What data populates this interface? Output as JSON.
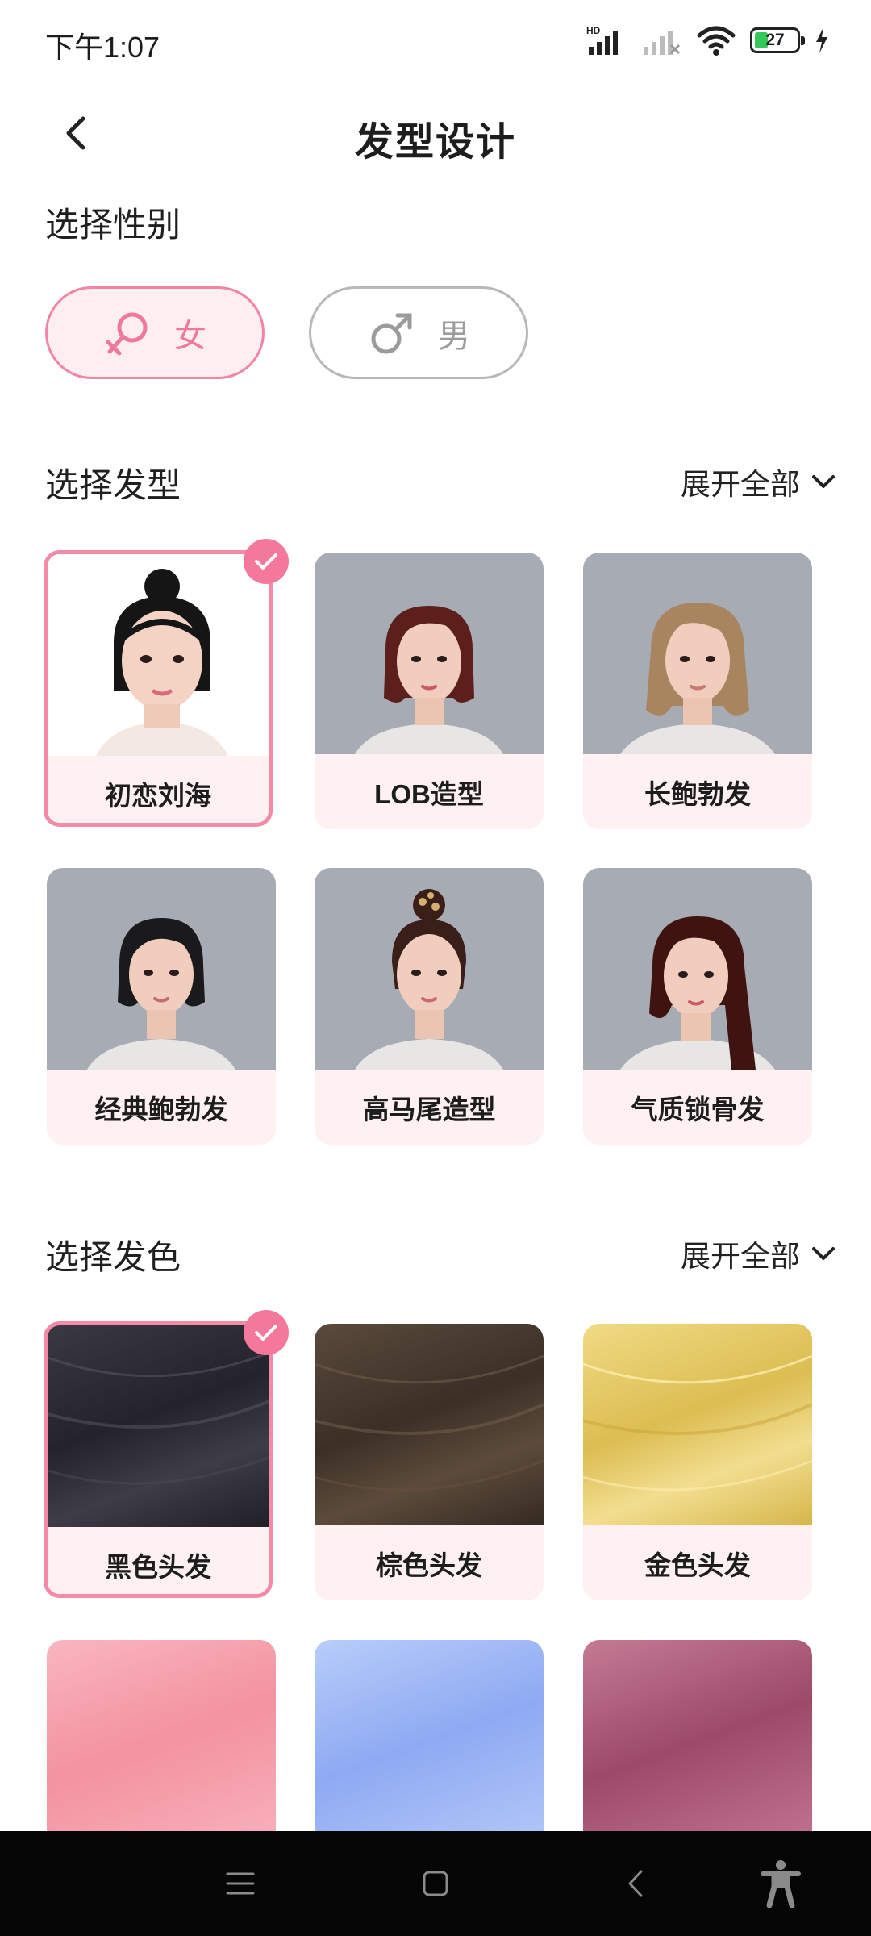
{
  "status": {
    "time": "下午1:07",
    "battery": "27",
    "network_label": "HD"
  },
  "header": {
    "title": "发型设计"
  },
  "gender": {
    "title": "选择性别",
    "options": [
      {
        "label": "女",
        "icon": "female-icon",
        "selected": true
      },
      {
        "label": "男",
        "icon": "male-icon",
        "selected": false
      }
    ]
  },
  "hairstyle": {
    "title": "选择发型",
    "expand_label": "展开全部",
    "items": [
      {
        "label": "初恋刘海",
        "selected": true
      },
      {
        "label": "LOB造型",
        "selected": false
      },
      {
        "label": "长鲍勃发",
        "selected": false
      },
      {
        "label": "经典鲍勃发",
        "selected": false
      },
      {
        "label": "高马尾造型",
        "selected": false
      },
      {
        "label": "气质锁骨发",
        "selected": false
      }
    ]
  },
  "haircolor": {
    "title": "选择发色",
    "expand_label": "展开全部",
    "items": [
      {
        "label": "黑色头发",
        "selected": true
      },
      {
        "label": "棕色头发",
        "selected": false
      },
      {
        "label": "金色头发",
        "selected": false
      }
    ]
  },
  "colors": {
    "accent": "#f4789c",
    "selected_border": "#f28aa8",
    "card_bg": "#fff1f2",
    "black_hair": "#2a2830",
    "brown_hair": "#4a3c30",
    "gold_hair": "#e3c660",
    "pink_hair": "#f7a2ae",
    "blue_hair": "#9eb8f4",
    "rose_hair": "#b4637f"
  }
}
